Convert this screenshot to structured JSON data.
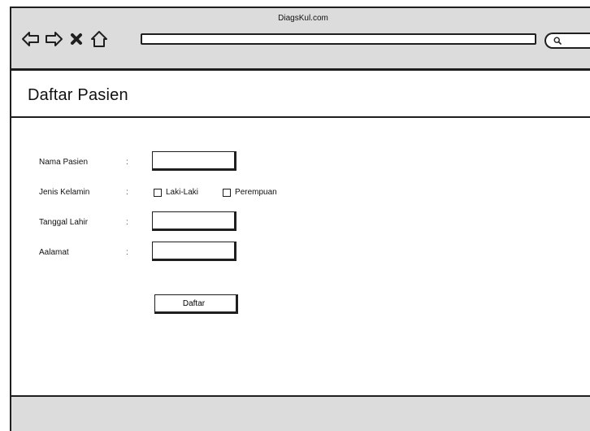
{
  "browser": {
    "site_name": "DiagsKul.com",
    "url_value": ""
  },
  "page": {
    "title": "Daftar Pasien"
  },
  "form": {
    "fields": [
      {
        "label": "Nama Pasien",
        "value": ""
      },
      {
        "label": "Jenis Kelamin"
      },
      {
        "label": "Tanggal Lahir",
        "value": ""
      },
      {
        "label": "Aalamat",
        "value": ""
      }
    ],
    "colon": ":",
    "gender_options": [
      {
        "label": "Laki-Laki",
        "checked": false
      },
      {
        "label": "Perempuan",
        "checked": false
      }
    ],
    "submit_label": "Daftar"
  },
  "icons": {
    "back": "back-arrow-icon",
    "forward": "forward-arrow-icon",
    "close": "close-icon",
    "home": "home-icon",
    "search": "search-icon"
  },
  "colors": {
    "chrome_gray": "#dcdcdc",
    "outline": "#1f1f1f",
    "page_background": "#ffffff"
  }
}
